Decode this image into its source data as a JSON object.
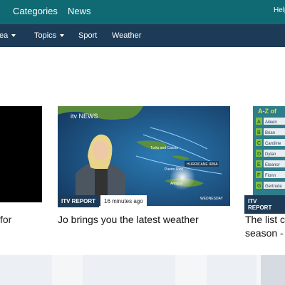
{
  "topbar": {
    "nav": [
      "Categories",
      "News"
    ],
    "help": "Help"
  },
  "subnav": {
    "items": [
      "Area",
      "Topics",
      "Sport",
      "Weather"
    ]
  },
  "cards": [
    {
      "title": "for"
    },
    {
      "badge": "ITV REPORT",
      "time": "16 minutes ago",
      "title": "Jo brings you the latest weather",
      "image_text": {
        "logo": "itv NEWS",
        "places": [
          "Turks and Caicos",
          "Puerto Rico",
          "Antigua",
          "HURRICANE IRMA"
        ],
        "day": "WEDNESDAY"
      }
    },
    {
      "badge": "ITV REPORT",
      "title_line1": "The list c",
      "title_line2": "season -",
      "az": {
        "heading": "A-Z of",
        "letters": [
          "A",
          "B",
          "C",
          "D",
          "E",
          "F",
          "G"
        ],
        "names": [
          "Aileen",
          "Brian",
          "Caroline",
          "Dylan",
          "Eleanor",
          "Fionn",
          "Gertrude"
        ]
      }
    }
  ],
  "colors": {
    "topbar": "#0f6a73",
    "subnav": "#1d3b57",
    "badge": "#1d3b57"
  }
}
